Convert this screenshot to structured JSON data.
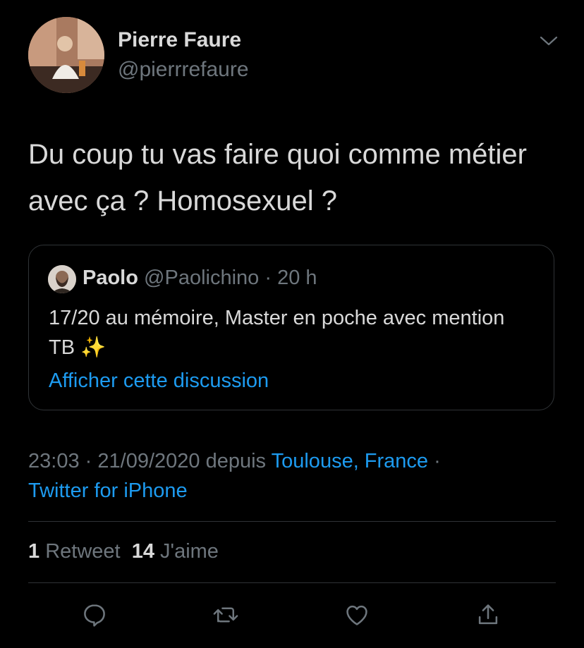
{
  "author": {
    "name": "Pierre Faure",
    "handle": "@pierrrefaure"
  },
  "tweet": {
    "text": "Du coup tu vas faire quoi comme métier avec ça ? Homosexuel ?"
  },
  "quoted": {
    "name": "Paolo",
    "handle": "@Paolichino",
    "separator": "·",
    "time": "20 h",
    "text": "17/20 au mémoire, Master en poche avec mention TB",
    "emoji": "✨",
    "link": "Afficher cette discussion"
  },
  "meta": {
    "time": "23:03",
    "sep1": "·",
    "date": "21/09/2020",
    "from": "depuis",
    "location": "Toulouse, France",
    "sep2": "·",
    "client": "Twitter for iPhone"
  },
  "stats": {
    "retweets_count": "1",
    "retweets_label": "Retweet",
    "likes_count": "14",
    "likes_label": "J'aime"
  },
  "actions": {
    "reply_icon": "reply-icon",
    "retweet_icon": "retweet-icon",
    "like_icon": "like-icon",
    "share_icon": "share-icon"
  },
  "colors": {
    "background": "#000000",
    "text": "#d9d9d9",
    "muted": "#6e767d",
    "link": "#1d9bf0",
    "border": "#2f3336"
  }
}
